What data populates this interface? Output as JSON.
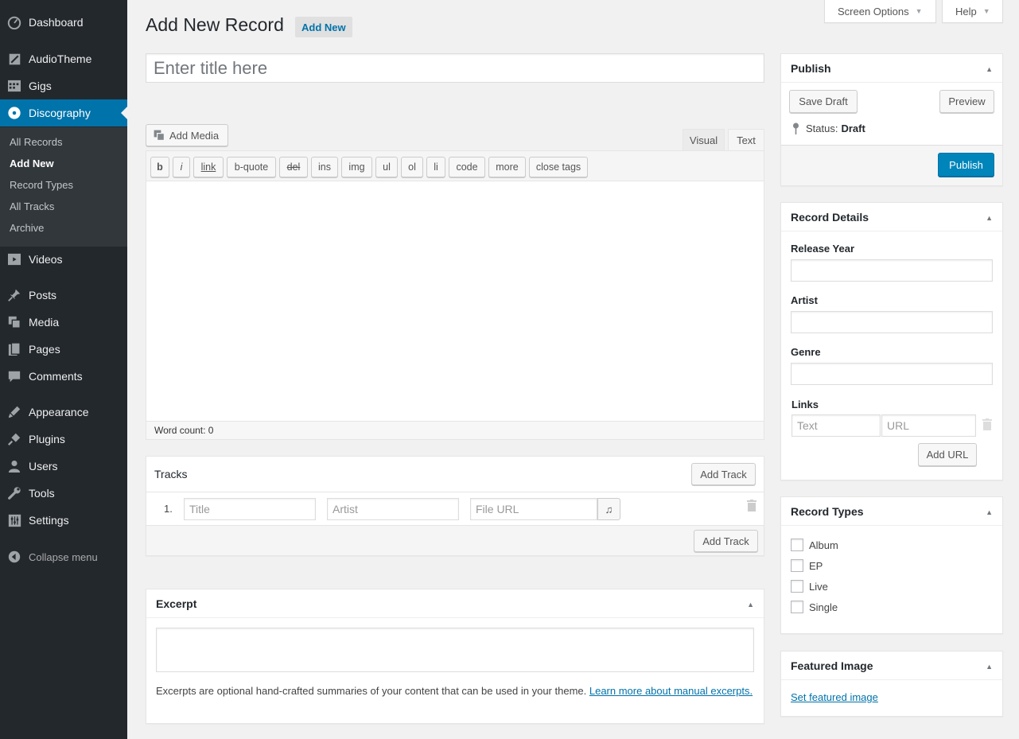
{
  "sidebar": {
    "menu": [
      {
        "label": "Dashboard",
        "icon": "dashboard-icon"
      },
      {
        "label": "AudioTheme",
        "icon": "audiotheme-icon"
      },
      {
        "label": "Gigs",
        "icon": "gigs-icon"
      },
      {
        "label": "Discography",
        "icon": "discography-icon"
      },
      {
        "label": "Videos",
        "icon": "videos-icon"
      },
      {
        "label": "Posts",
        "icon": "pin-icon"
      },
      {
        "label": "Media",
        "icon": "media-icon"
      },
      {
        "label": "Pages",
        "icon": "pages-icon"
      },
      {
        "label": "Comments",
        "icon": "comments-icon"
      },
      {
        "label": "Appearance",
        "icon": "appearance-icon"
      },
      {
        "label": "Plugins",
        "icon": "plugins-icon"
      },
      {
        "label": "Users",
        "icon": "users-icon"
      },
      {
        "label": "Tools",
        "icon": "tools-icon"
      },
      {
        "label": "Settings",
        "icon": "settings-icon"
      }
    ],
    "submenu": [
      "All Records",
      "Add New",
      "Record Types",
      "All Tracks",
      "Archive"
    ],
    "collapse": "Collapse menu"
  },
  "top": {
    "screen_options": "Screen Options",
    "help": "Help"
  },
  "header": {
    "title": "Add New Record",
    "add_new": "Add New"
  },
  "title_input": {
    "placeholder": "Enter title here"
  },
  "editor": {
    "add_media": "Add Media",
    "tab_visual": "Visual",
    "tab_text": "Text",
    "quicktags": [
      "b",
      "i",
      "link",
      "b-quote",
      "del",
      "ins",
      "img",
      "ul",
      "ol",
      "li",
      "code",
      "more",
      "close tags"
    ],
    "word_count": "Word count: 0"
  },
  "tracks": {
    "title": "Tracks",
    "add_track": "Add Track",
    "row_number": "1.",
    "title_placeholder": "Title",
    "artist_placeholder": "Artist",
    "file_placeholder": "File URL"
  },
  "excerpt": {
    "title": "Excerpt",
    "help_text": "Excerpts are optional hand-crafted summaries of your content that can be used in your theme. ",
    "link_text": "Learn more about manual excerpts."
  },
  "publish": {
    "title": "Publish",
    "save_draft": "Save Draft",
    "preview": "Preview",
    "status_label": "Status:",
    "status_value": "Draft",
    "publish_button": "Publish"
  },
  "record_details": {
    "title": "Record Details",
    "release_year": "Release Year",
    "artist": "Artist",
    "genre": "Genre",
    "links": "Links",
    "text_placeholder": "Text",
    "url_placeholder": "URL",
    "add_url": "Add URL"
  },
  "record_types": {
    "title": "Record Types",
    "options": [
      "Album",
      "EP",
      "Live",
      "Single"
    ]
  },
  "featured_image": {
    "title": "Featured Image",
    "link": "Set featured image"
  },
  "colors": {
    "sidebar": "#23282d",
    "active": "#0073aa",
    "primary": "#0085ba",
    "link": "#0073aa"
  }
}
